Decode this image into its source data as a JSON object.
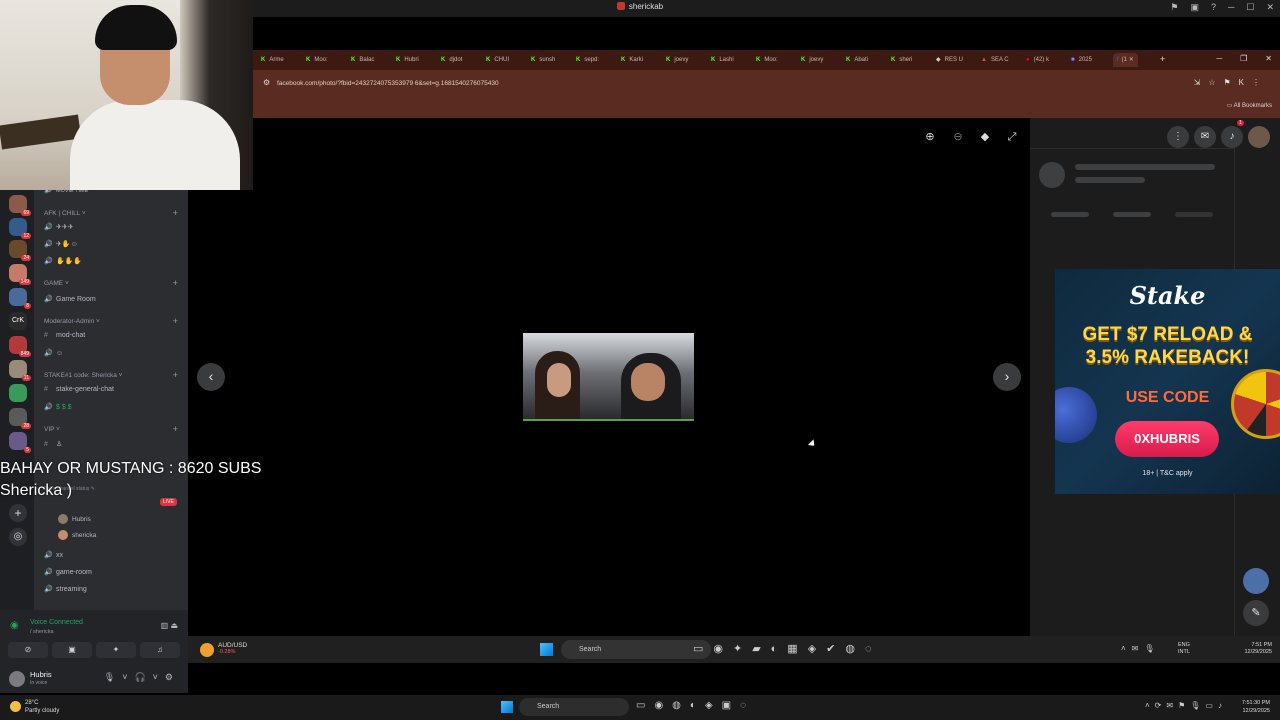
{
  "window": {
    "title": "sherickab"
  },
  "overlay": {
    "line1": "BAHAY OR MUSTANG : 8620 SUBS",
    "line2": "Shericka )"
  },
  "browser": {
    "tabs": [
      "Arme",
      "Moo:",
      "Balac",
      "Hubri",
      "djdot",
      "CHUI",
      "sunsh",
      "sepd:",
      "Karki",
      "joevy",
      "Lashi",
      "Moo:",
      "joevy",
      "Abati",
      "sheri",
      "RES U",
      "SEA C",
      "(42) k",
      "2025",
      "(1"
    ],
    "url": "facebook.com/photo/?fbid=2432724075353979 6&set=g.1681540276075430",
    "bookmarks_label": "All Bookmarks"
  },
  "discord": {
    "categories": [
      {
        "label": "AFK | CHILL"
      },
      {
        "label": "GAME"
      },
      {
        "label": "Moderator-Admin"
      },
      {
        "label": "STAKE#1 code: Shericka"
      },
      {
        "label": "VIP"
      }
    ],
    "channels": {
      "movie": "MOVIE TIME",
      "game_room": "Game Room",
      "mod_chat": "mod-chat",
      "stake_general": "stake-general-chat",
      "xx": "xx",
      "game_room2": "game-room",
      "streaming": "streaming",
      "set_status": "Set a channel status"
    },
    "voice_users": [
      "Hubris",
      "shericka"
    ],
    "live_badge": "LIVE",
    "voice_connected": "Voice Connected",
    "voice_sub": "/ shericka",
    "user": {
      "name": "Hubris",
      "status": "In voice"
    },
    "server_badges": [
      "69",
      "12",
      "24",
      "149",
      "8",
      "849",
      "11",
      "28",
      "5"
    ]
  },
  "ad": {
    "brand": "Stake",
    "headline1": "GET $7 RELOAD &",
    "headline2": "3.5% RAKEBACK!",
    "use_code": "USE CODE",
    "code": "0XHUBRIS",
    "terms": "18+ | T&C apply"
  },
  "facebook": {
    "notif_count": "1"
  },
  "inner_taskbar": {
    "pair": "AUD/USD",
    "change": "-0.28%",
    "search": "Search",
    "lang1": "ENG",
    "lang2": "INTL",
    "time": "7:51 PM",
    "date": "12/29/2025"
  },
  "taskbar": {
    "temp": "28°C",
    "weather": "Partly cloudy",
    "search": "Search",
    "time": "7:51:30 PM",
    "date": "12/29/2025"
  }
}
